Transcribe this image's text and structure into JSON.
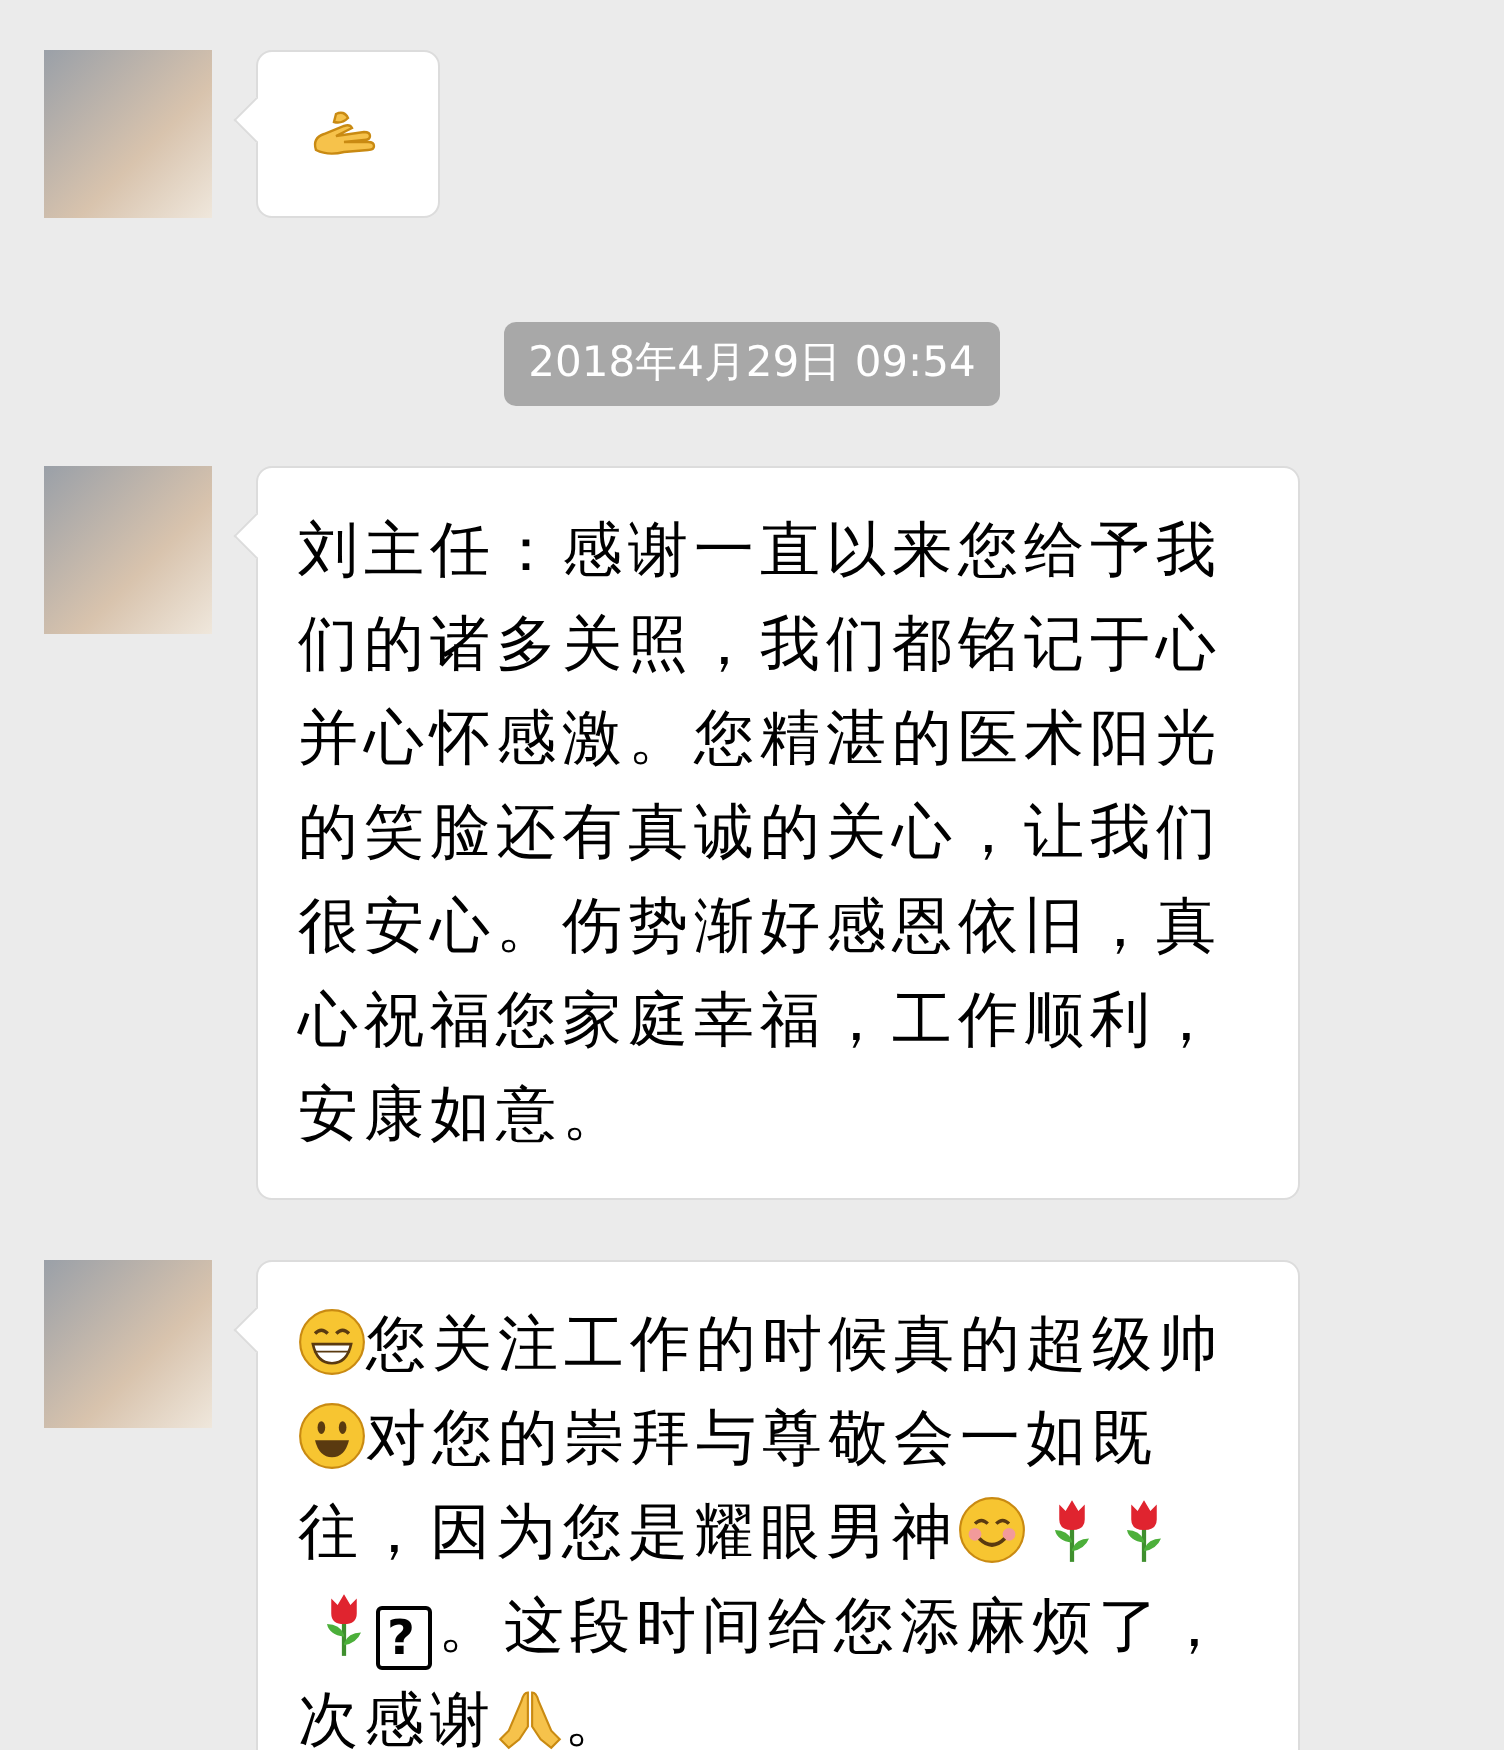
{
  "chat": [
    {
      "kind": "message",
      "lines": [
        [
          {
            "kind": "hand"
          }
        ]
      ]
    },
    {
      "kind": "timestamp",
      "text": "2018年4月29日 09:54"
    },
    {
      "kind": "message",
      "lines": [
        [
          {
            "kind": "text",
            "text": "刘主任：感谢一直以来您给予我们的诸多关照，我们都铭记于心并心怀感激。您精湛的医术阳光的笑脸还有真诚的关心，让我们很安心。伤势渐好感恩依旧，真心祝福您家庭幸福，工作顺利，安康如意。"
          }
        ]
      ]
    },
    {
      "kind": "message",
      "lines": [
        [
          {
            "kind": "grin"
          },
          {
            "kind": "text",
            "text": "您关注工作的时候真的超级帅"
          }
        ],
        [
          {
            "kind": "smiley"
          },
          {
            "kind": "text",
            "text": "对您的崇拜与尊敬会一如既"
          }
        ],
        [
          {
            "kind": "text",
            "text": "往，因为您是耀眼男神"
          },
          {
            "kind": "blush"
          },
          {
            "kind": "rose"
          },
          {
            "kind": "rose"
          }
        ],
        [
          {
            "kind": "rose"
          },
          {
            "kind": "missing",
            "text": "?"
          },
          {
            "kind": "text",
            "text": "。这段时间给您添麻烦了，"
          }
        ],
        [
          {
            "kind": "text",
            "text": "次感谢"
          },
          {
            "kind": "pray"
          },
          {
            "kind": "text",
            "text": "。"
          }
        ]
      ]
    }
  ]
}
